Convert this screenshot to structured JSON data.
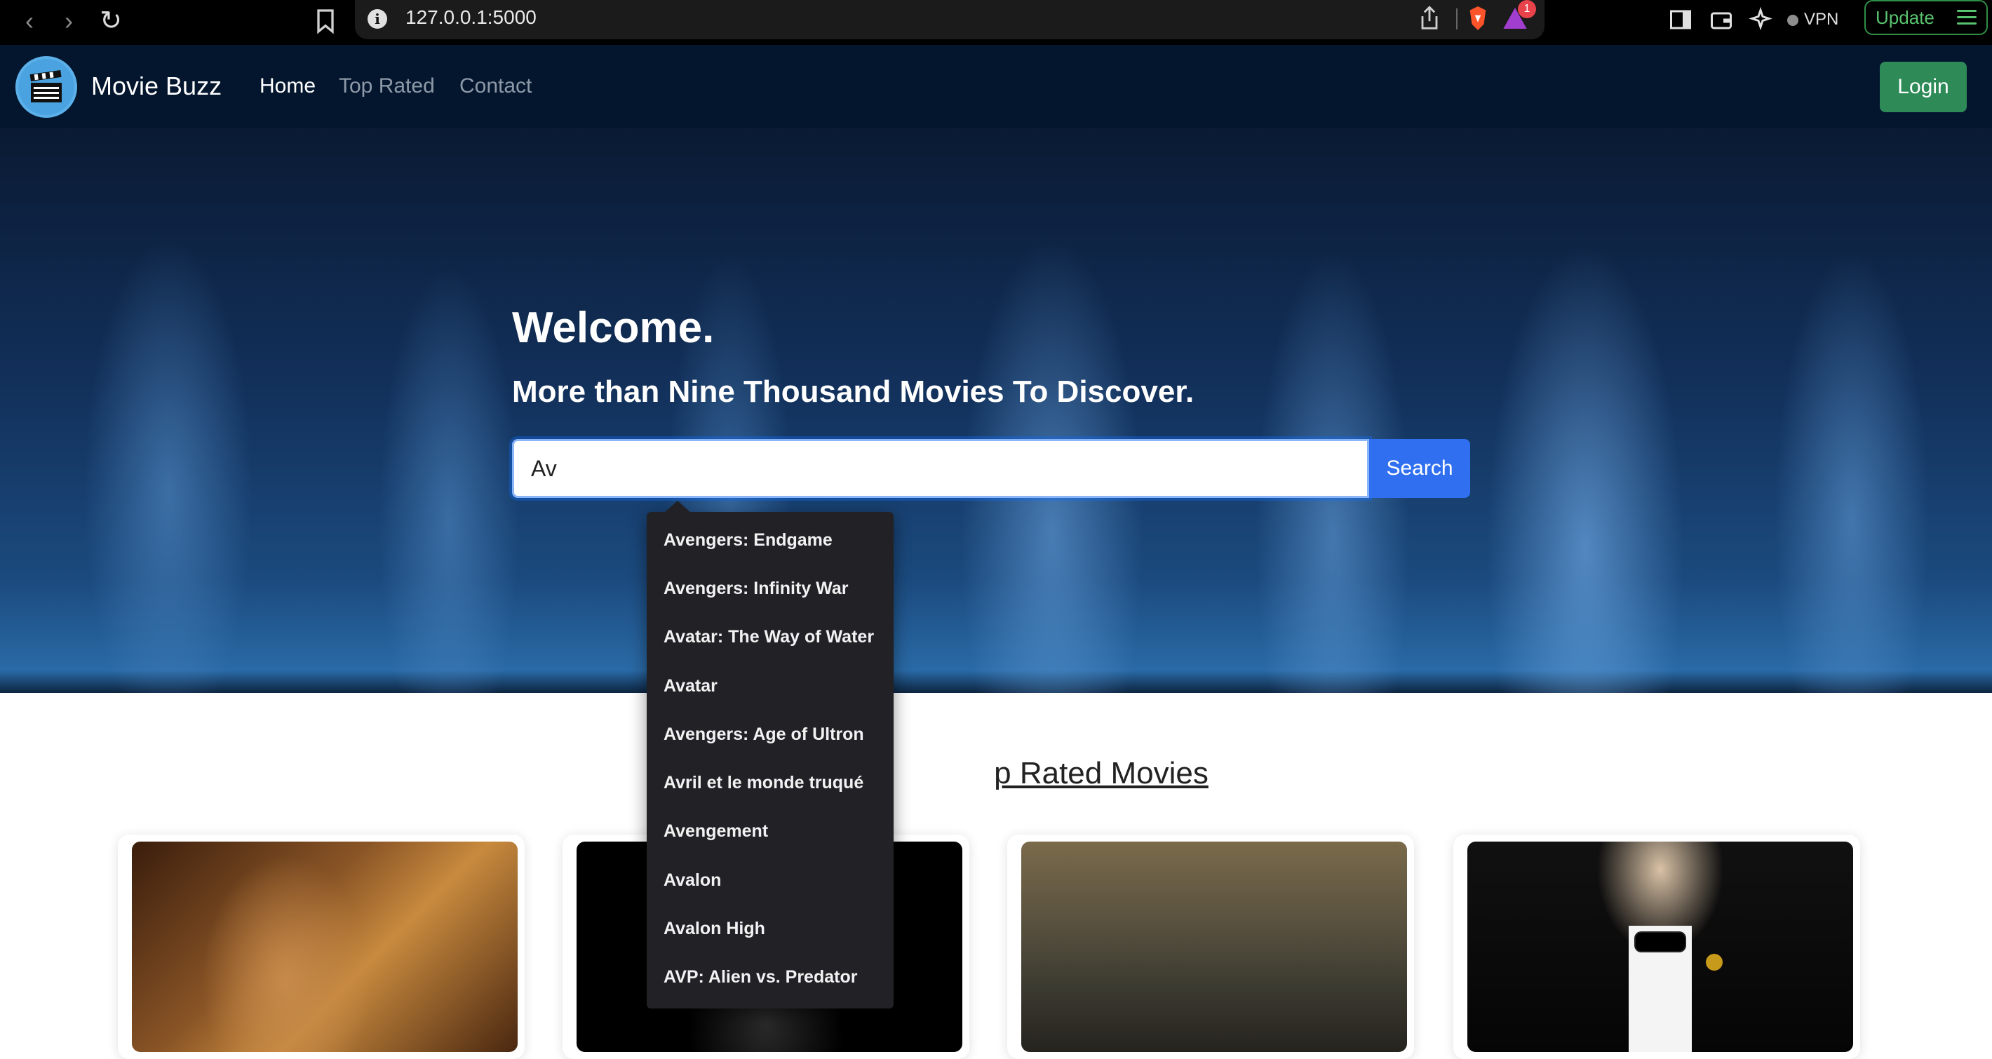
{
  "browser": {
    "url": "127.0.0.1:5000",
    "vpn_label": "VPN",
    "update_label": "Update",
    "rewards_badge": "1"
  },
  "nav": {
    "brand": "Movie Buzz",
    "links": [
      "Home",
      "Top Rated",
      "Contact"
    ],
    "active": "Home",
    "login_label": "Login"
  },
  "hero": {
    "title": "Welcome.",
    "subtitle": "More than Nine Thousand Movies To Discover.",
    "search_value": "Av",
    "search_button": "Search"
  },
  "autocomplete": {
    "suggestions": [
      "Avengers: Endgame",
      "Avengers: Infinity War",
      "Avatar: The Way of Water",
      "Avatar",
      "Avengers: Age of Ultron",
      "Avril et le monde truqué",
      "Avengement",
      "Avalon",
      "Avalon High",
      "AVP: Alien vs. Predator"
    ]
  },
  "section": {
    "title": "Top Rated Movies",
    "visible_title": "p Rated Movies"
  }
}
